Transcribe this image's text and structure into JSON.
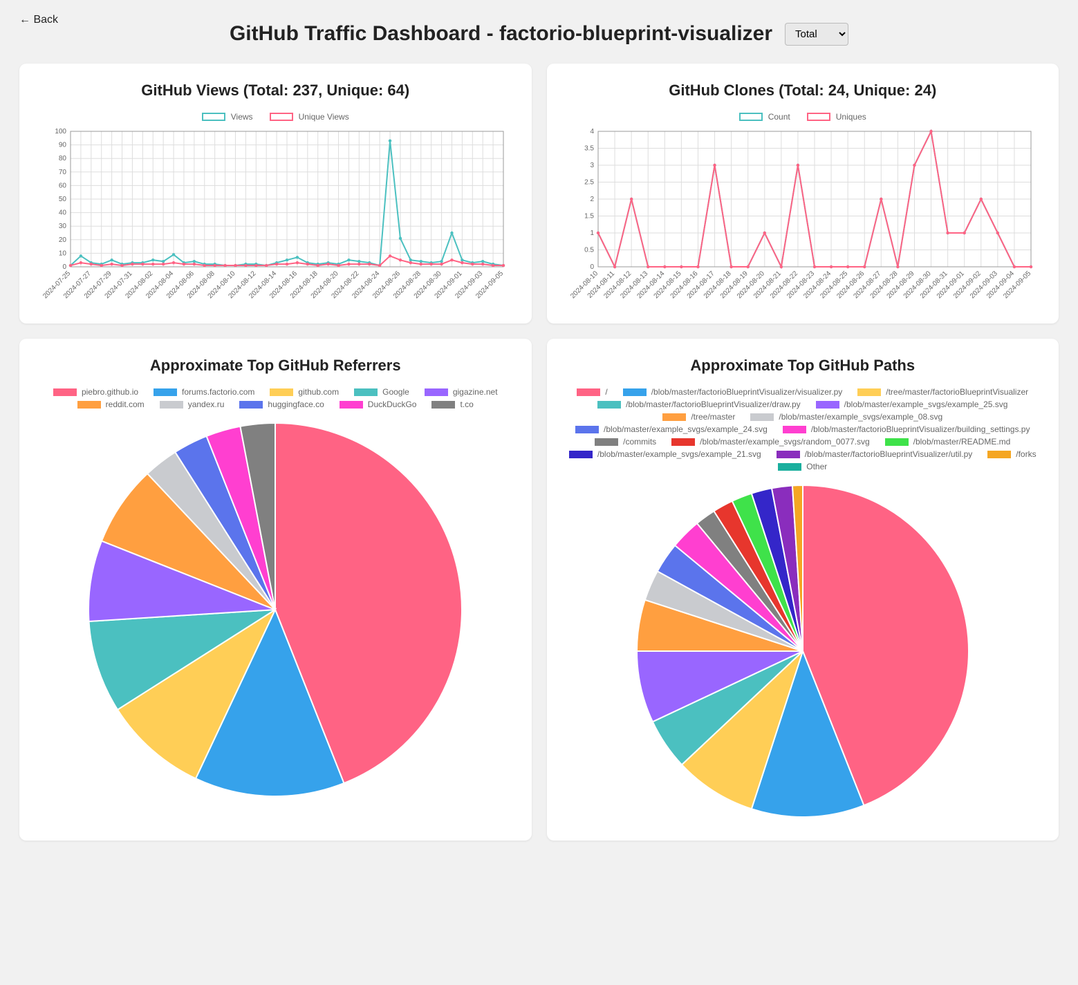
{
  "nav": {
    "back": "← Back"
  },
  "header": {
    "title": "GitHub Traffic Dashboard - factorio-blueprint-visualizer",
    "select_value": "Total"
  },
  "cards": {
    "views": {
      "title": "GitHub Views (Total: 237, Unique: 64)",
      "legend": [
        {
          "name": "Views",
          "color": "#4bc0c0"
        },
        {
          "name": "Unique Views",
          "color": "#ff6384"
        }
      ]
    },
    "clones": {
      "title": "GitHub Clones (Total: 24, Unique: 24)",
      "legend": [
        {
          "name": "Count",
          "color": "#4bc0c0"
        },
        {
          "name": "Uniques",
          "color": "#ff6384"
        }
      ]
    },
    "referrers": {
      "title": "Approximate Top GitHub Referrers"
    },
    "paths": {
      "title": "Approximate Top GitHub Paths"
    }
  },
  "chart_data": [
    {
      "id": "views",
      "type": "line",
      "xlabel": "",
      "ylabel": "",
      "ylim": [
        0,
        100
      ],
      "yticks": [
        0,
        10,
        20,
        30,
        40,
        50,
        60,
        70,
        80,
        90,
        100
      ],
      "categories": [
        "2024-07-25",
        "2024-07-26",
        "2024-07-27",
        "2024-07-28",
        "2024-07-29",
        "2024-07-30",
        "2024-07-31",
        "2024-08-01",
        "2024-08-02",
        "2024-08-03",
        "2024-08-04",
        "2024-08-05",
        "2024-08-06",
        "2024-08-07",
        "2024-08-08",
        "2024-08-09",
        "2024-08-10",
        "2024-08-11",
        "2024-08-12",
        "2024-08-13",
        "2024-08-14",
        "2024-08-15",
        "2024-08-16",
        "2024-08-17",
        "2024-08-18",
        "2024-08-19",
        "2024-08-20",
        "2024-08-21",
        "2024-08-22",
        "2024-08-23",
        "2024-08-24",
        "2024-08-25",
        "2024-08-26",
        "2024-08-27",
        "2024-08-28",
        "2024-08-29",
        "2024-08-30",
        "2024-08-31",
        "2024-09-01",
        "2024-09-02",
        "2024-09-03",
        "2024-09-04",
        "2024-09-05"
      ],
      "xticks_every": 2,
      "series": [
        {
          "name": "Views",
          "color": "#4bc0c0",
          "values": [
            1,
            8,
            3,
            2,
            5,
            2,
            3,
            3,
            5,
            4,
            9,
            3,
            4,
            2,
            2,
            1,
            1,
            2,
            2,
            1,
            3,
            5,
            7,
            3,
            2,
            3,
            2,
            5,
            4,
            3,
            1,
            93,
            21,
            5,
            4,
            3,
            4,
            25,
            5,
            3,
            4,
            2,
            1
          ]
        },
        {
          "name": "Unique Views",
          "color": "#ff6384",
          "values": [
            1,
            3,
            2,
            1,
            2,
            1,
            2,
            2,
            2,
            2,
            3,
            2,
            2,
            1,
            1,
            1,
            1,
            1,
            1,
            1,
            2,
            2,
            3,
            2,
            1,
            2,
            1,
            2,
            2,
            2,
            1,
            8,
            5,
            3,
            2,
            2,
            2,
            5,
            3,
            2,
            2,
            1,
            1
          ]
        }
      ]
    },
    {
      "id": "clones",
      "type": "line",
      "xlabel": "",
      "ylabel": "",
      "ylim": [
        0,
        4
      ],
      "yticks": [
        0,
        0.5,
        1.0,
        1.5,
        2.0,
        2.5,
        3.0,
        3.5,
        4.0
      ],
      "categories": [
        "2024-08-10",
        "2024-08-11",
        "2024-08-12",
        "2024-08-13",
        "2024-08-14",
        "2024-08-15",
        "2024-08-16",
        "2024-08-17",
        "2024-08-18",
        "2024-08-19",
        "2024-08-20",
        "2024-08-21",
        "2024-08-22",
        "2024-08-23",
        "2024-08-24",
        "2024-08-25",
        "2024-08-26",
        "2024-08-27",
        "2024-08-28",
        "2024-08-29",
        "2024-08-30",
        "2024-08-31",
        "2024-09-01",
        "2024-09-02",
        "2024-09-03",
        "2024-09-04",
        "2024-09-05"
      ],
      "xticks_every": 1,
      "series": [
        {
          "name": "Count",
          "color": "#4bc0c0",
          "values": [
            1,
            0,
            2,
            0,
            0,
            0,
            0,
            3,
            0,
            0,
            1,
            0,
            3,
            0,
            0,
            0,
            0,
            2,
            0,
            3,
            4,
            1,
            1,
            2,
            1,
            0,
            0
          ]
        },
        {
          "name": "Uniques",
          "color": "#ff6384",
          "values": [
            1,
            0,
            2,
            0,
            0,
            0,
            0,
            3,
            0,
            0,
            1,
            0,
            3,
            0,
            0,
            0,
            0,
            2,
            0,
            3,
            4,
            1,
            1,
            2,
            1,
            0,
            0
          ]
        }
      ]
    },
    {
      "id": "referrers",
      "type": "pie",
      "slices": [
        {
          "label": "piebro.github.io",
          "value": 44,
          "color": "#ff6384"
        },
        {
          "label": "forums.factorio.com",
          "value": 13,
          "color": "#36a2eb"
        },
        {
          "label": "github.com",
          "value": 9,
          "color": "#ffce56"
        },
        {
          "label": "Google",
          "value": 8,
          "color": "#4bc0c0"
        },
        {
          "label": "gigazine.net",
          "value": 7,
          "color": "#9966ff"
        },
        {
          "label": "reddit.com",
          "value": 7,
          "color": "#ff9f40"
        },
        {
          "label": "yandex.ru",
          "value": 3,
          "color": "#c9cbcf"
        },
        {
          "label": "huggingface.co",
          "value": 3,
          "color": "#5b74ec"
        },
        {
          "label": "DuckDuckGo",
          "value": 3,
          "color": "#ff3fd0"
        },
        {
          "label": "t.co",
          "value": 3,
          "color": "#808080"
        }
      ]
    },
    {
      "id": "paths",
      "type": "pie",
      "slices": [
        {
          "label": "/",
          "value": 44,
          "color": "#ff6384"
        },
        {
          "label": "/blob/master/factorioBlueprintVisualizer/visualizer.py",
          "value": 11,
          "color": "#36a2eb"
        },
        {
          "label": "/tree/master/factorioBlueprintVisualizer",
          "value": 8,
          "color": "#ffce56"
        },
        {
          "label": "/blob/master/factorioBlueprintVisualizer/draw.py",
          "value": 5,
          "color": "#4bc0c0"
        },
        {
          "label": "/blob/master/example_svgs/example_25.svg",
          "value": 7,
          "color": "#9966ff"
        },
        {
          "label": "/tree/master",
          "value": 5,
          "color": "#ff9f40"
        },
        {
          "label": "/blob/master/example_svgs/example_08.svg",
          "value": 3,
          "color": "#c9cbcf"
        },
        {
          "label": "/blob/master/example_svgs/example_24.svg",
          "value": 3,
          "color": "#5b74ec"
        },
        {
          "label": "/blob/master/factorioBlueprintVisualizer/building_settings.py",
          "value": 3,
          "color": "#ff3fd0"
        },
        {
          "label": "/commits",
          "value": 2,
          "color": "#808080"
        },
        {
          "label": "/blob/master/example_svgs/random_0077.svg",
          "value": 2,
          "color": "#e7362d"
        },
        {
          "label": "/blob/master/README.md",
          "value": 2,
          "color": "#3fe24a"
        },
        {
          "label": "/blob/master/example_svgs/example_21.svg",
          "value": 2,
          "color": "#3426c9"
        },
        {
          "label": "/blob/master/factorioBlueprintVisualizer/util.py",
          "value": 2,
          "color": "#8a2dbd"
        },
        {
          "label": "/forks",
          "value": 1,
          "color": "#f5a623"
        },
        {
          "label": "Other",
          "value": 0,
          "color": "#1aaf9e"
        }
      ]
    }
  ]
}
